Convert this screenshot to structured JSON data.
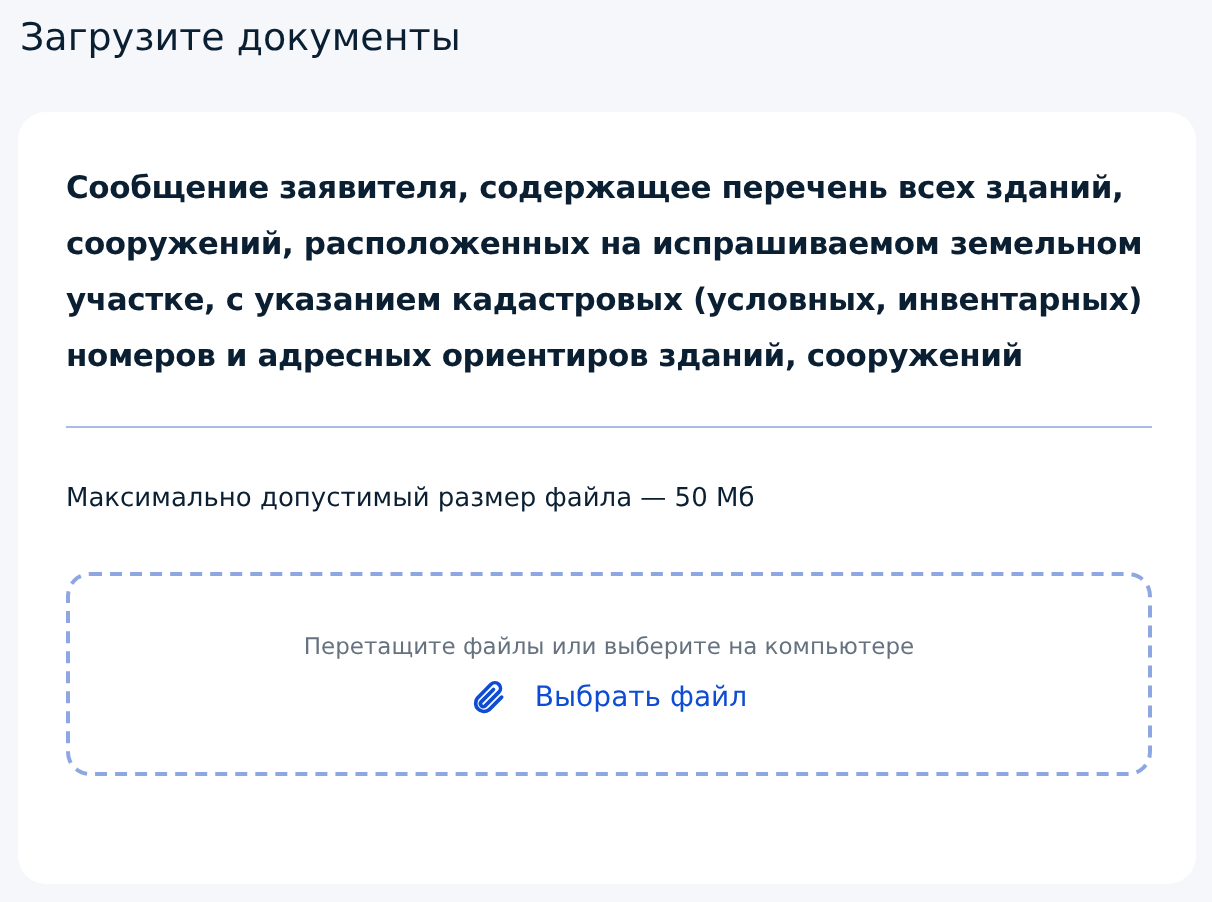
{
  "page": {
    "title": "Загрузите документы"
  },
  "document": {
    "title": "Сообщение заявителя, содержащее перечень всех зданий, сооружений, расположенных на испрашиваемом земельном участке, с указанием кадастровых (условных, инвентарных) номеров и адресных ориентиров зданий, сооружений",
    "size_limit": "Максимально допустимый размер файла — 50 Мб"
  },
  "dropzone": {
    "hint": "Перетащите файлы или выберите на компьютере",
    "button": "Выбрать файл"
  }
}
